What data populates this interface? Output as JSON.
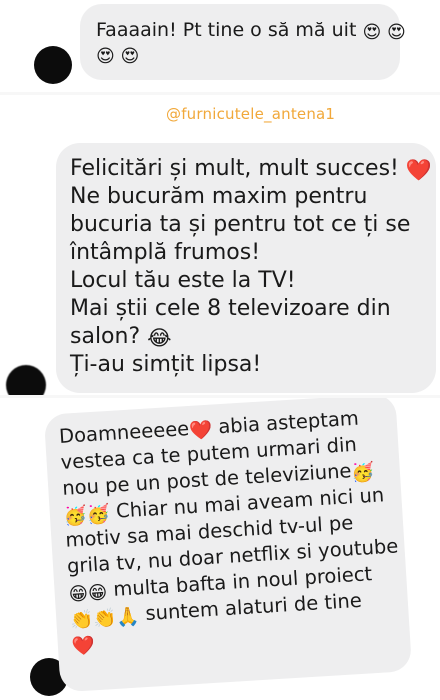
{
  "messages": [
    {
      "lines": [
        {
          "text": "Faaaain! Pt tine o să mă uit",
          "emoji": "😍 😍"
        },
        {
          "text": "",
          "emoji": "😍 😍"
        }
      ]
    },
    {
      "mention": "@furnicutele_antena1",
      "lines": [
        {
          "text": "Felicitări și mult, mult succes! ",
          "emoji": "❤️"
        },
        {
          "text": "Ne bucurăm maxim pentru",
          "emoji": ""
        },
        {
          "text": "bucuria ta și pentru tot ce ți se",
          "emoji": ""
        },
        {
          "text": "întâmplă frumos!",
          "emoji": ""
        },
        {
          "text": "Locul tău este la TV!",
          "emoji": ""
        },
        {
          "text": "Mai știi cele 8 televizoare din",
          "emoji": ""
        },
        {
          "text": "salon? ",
          "emoji": "😂"
        },
        {
          "text": "Ți-au simțit lipsa!",
          "emoji": ""
        }
      ]
    },
    {
      "lines": [
        {
          "text": "Doamneeeee",
          "emoji": "❤️",
          "after": " abia asteptam"
        },
        {
          "text": "vestea ca te putem urmari din",
          "emoji": ""
        },
        {
          "text": "nou pe un post de televiziune",
          "emoji": "🥳"
        },
        {
          "text": "",
          "emoji": "🥳🥳",
          "after": " Chiar nu mai aveam nici un"
        },
        {
          "text": "motiv sa mai deschid tv-ul pe",
          "emoji": ""
        },
        {
          "text": "grila tv, nu doar netflix si youtube",
          "emoji": ""
        },
        {
          "text": "",
          "emoji": "😁😁",
          "after": " multa bafta in noul proiect"
        },
        {
          "text": "",
          "emoji": "👏👏🙏",
          "after": " suntem alaturi de tine"
        },
        {
          "text": "",
          "emoji": "❤️"
        }
      ]
    }
  ],
  "colors": {
    "bubble": "#eeeeef",
    "mention": "#f1a83a",
    "avatar": "#0c0c0c"
  }
}
